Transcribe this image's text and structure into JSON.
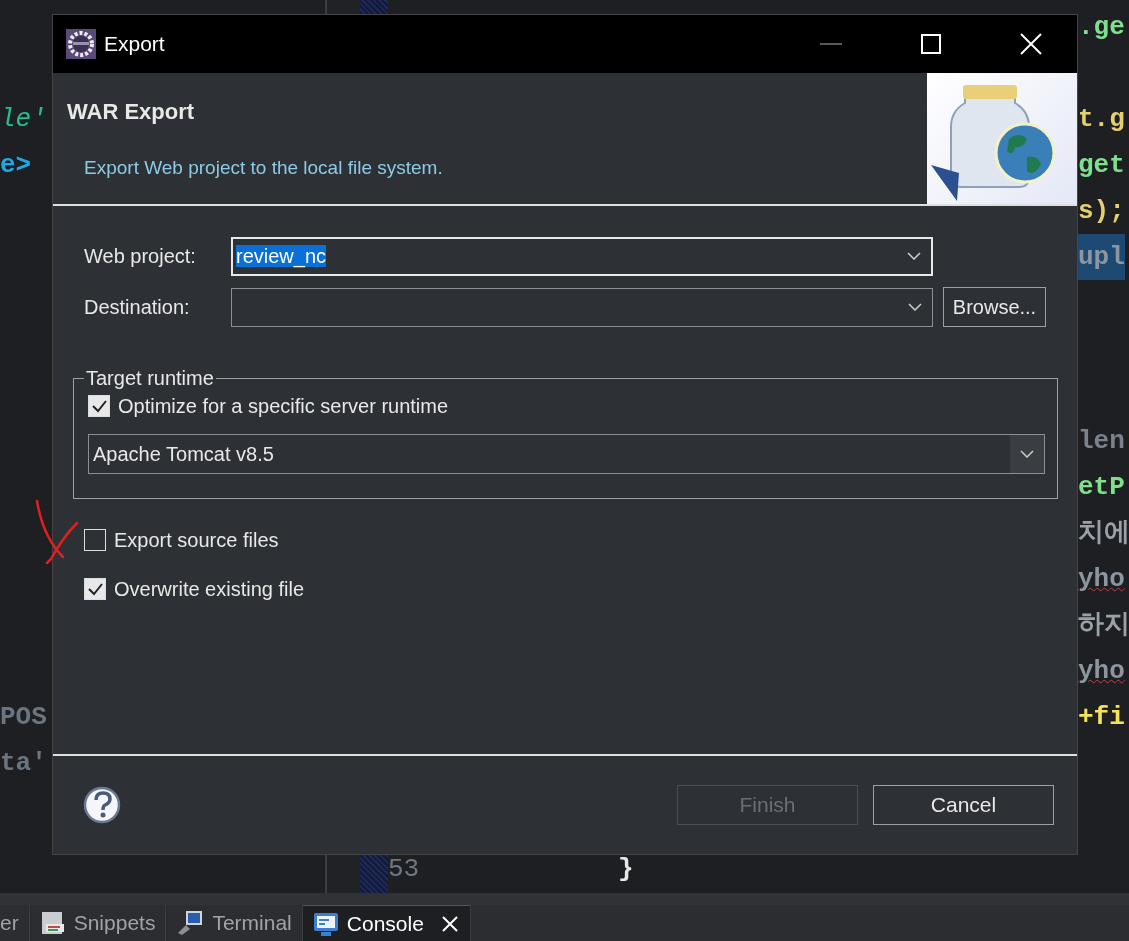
{
  "editor": {
    "left_fragments": [
      {
        "text": "le'",
        "color": "#22c08f"
      },
      {
        "text": "e>",
        "color": "#1ea8e6"
      },
      {
        "text": "POS",
        "color": "#6b7580"
      },
      {
        "text": "ta'",
        "color": "#6b7580"
      }
    ],
    "right_fragments": [
      {
        "text": ".ge",
        "color": "#7ee08a",
        "highlighted": false,
        "flagged": false
      },
      {
        "text": "t.g",
        "color": "#e6cf6e",
        "highlighted": false,
        "flagged": false
      },
      {
        "text": "get",
        "color": "#7ee08a",
        "highlighted": false,
        "flagged": false
      },
      {
        "text": "s);",
        "color": "#e6cf6e",
        "highlighted": false,
        "flagged": false
      },
      {
        "text": "upl",
        "color": "#8d959e",
        "highlighted": true,
        "flagged": false
      },
      {
        "text": "len",
        "color": "#7a828b",
        "highlighted": false,
        "flagged": false
      },
      {
        "text": "etP",
        "color": "#7ee08a",
        "highlighted": false,
        "flagged": false
      },
      {
        "text": "치에",
        "color": "#9aa1a8",
        "highlighted": false,
        "flagged": false
      },
      {
        "text": "yho",
        "color": "#8d959e",
        "highlighted": false,
        "flagged": true
      },
      {
        "text": "하지",
        "color": "#9aa1a8",
        "highlighted": false,
        "flagged": false
      },
      {
        "text": "yho",
        "color": "#8d959e",
        "highlighted": false,
        "flagged": true
      },
      {
        "text": "+fi",
        "color": "#f2e35a",
        "highlighted": false,
        "flagged": false
      }
    ],
    "line_number": "53",
    "brace": "}"
  },
  "dialog": {
    "title": "Export",
    "banner": {
      "title": "WAR Export",
      "description": "Export Web project to the local file system."
    },
    "fields": [
      {
        "label": "Web project:",
        "value": "review_nc",
        "value_selected": true,
        "focused": true
      },
      {
        "label": "Destination:",
        "focused": false,
        "button": "Browse..."
      }
    ],
    "target_runtime": {
      "legend": "Target runtime",
      "optimize": {
        "label": "Optimize for a specific server runtime",
        "checked": true
      },
      "runtime": "Apache Tomcat v8.5"
    },
    "options": [
      {
        "label": "Export source files",
        "checked": false
      },
      {
        "label": "Overwrite existing file",
        "checked": true
      }
    ],
    "buttons": [
      {
        "label": "Finish",
        "disabled": true
      },
      {
        "label": "Cancel",
        "disabled": false
      }
    ]
  },
  "bottom_tabs": [
    {
      "label": "er",
      "selected": false
    },
    {
      "label": "Snippets",
      "selected": false
    },
    {
      "label": "Terminal",
      "selected": false
    },
    {
      "label": "Console",
      "selected": true
    }
  ]
}
